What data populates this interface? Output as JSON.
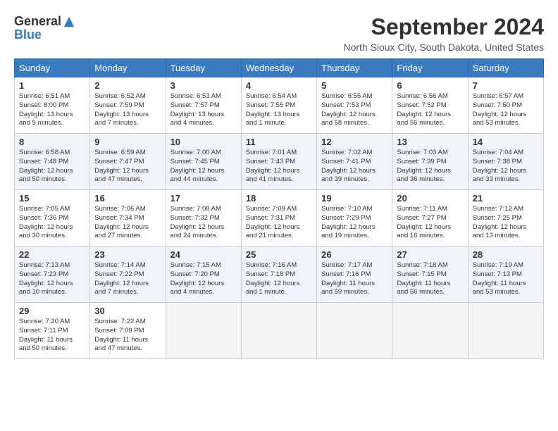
{
  "logo": {
    "general": "General",
    "blue": "Blue"
  },
  "title": "September 2024",
  "location": "North Sioux City, South Dakota, United States",
  "days_of_week": [
    "Sunday",
    "Monday",
    "Tuesday",
    "Wednesday",
    "Thursday",
    "Friday",
    "Saturday"
  ],
  "weeks": [
    [
      {
        "day": "1",
        "info": "Sunrise: 6:51 AM\nSunset: 8:00 PM\nDaylight: 13 hours\nand 9 minutes."
      },
      {
        "day": "2",
        "info": "Sunrise: 6:52 AM\nSunset: 7:59 PM\nDaylight: 13 hours\nand 7 minutes."
      },
      {
        "day": "3",
        "info": "Sunrise: 6:53 AM\nSunset: 7:57 PM\nDaylight: 13 hours\nand 4 minutes."
      },
      {
        "day": "4",
        "info": "Sunrise: 6:54 AM\nSunset: 7:55 PM\nDaylight: 13 hours\nand 1 minute."
      },
      {
        "day": "5",
        "info": "Sunrise: 6:55 AM\nSunset: 7:53 PM\nDaylight: 12 hours\nand 58 minutes."
      },
      {
        "day": "6",
        "info": "Sunrise: 6:56 AM\nSunset: 7:52 PM\nDaylight: 12 hours\nand 55 minutes."
      },
      {
        "day": "7",
        "info": "Sunrise: 6:57 AM\nSunset: 7:50 PM\nDaylight: 12 hours\nand 53 minutes."
      }
    ],
    [
      {
        "day": "8",
        "info": "Sunrise: 6:58 AM\nSunset: 7:48 PM\nDaylight: 12 hours\nand 50 minutes."
      },
      {
        "day": "9",
        "info": "Sunrise: 6:59 AM\nSunset: 7:47 PM\nDaylight: 12 hours\nand 47 minutes."
      },
      {
        "day": "10",
        "info": "Sunrise: 7:00 AM\nSunset: 7:45 PM\nDaylight: 12 hours\nand 44 minutes."
      },
      {
        "day": "11",
        "info": "Sunrise: 7:01 AM\nSunset: 7:43 PM\nDaylight: 12 hours\nand 41 minutes."
      },
      {
        "day": "12",
        "info": "Sunrise: 7:02 AM\nSunset: 7:41 PM\nDaylight: 12 hours\nand 39 minutes."
      },
      {
        "day": "13",
        "info": "Sunrise: 7:03 AM\nSunset: 7:39 PM\nDaylight: 12 hours\nand 36 minutes."
      },
      {
        "day": "14",
        "info": "Sunrise: 7:04 AM\nSunset: 7:38 PM\nDaylight: 12 hours\nand 33 minutes."
      }
    ],
    [
      {
        "day": "15",
        "info": "Sunrise: 7:05 AM\nSunset: 7:36 PM\nDaylight: 12 hours\nand 30 minutes."
      },
      {
        "day": "16",
        "info": "Sunrise: 7:06 AM\nSunset: 7:34 PM\nDaylight: 12 hours\nand 27 minutes."
      },
      {
        "day": "17",
        "info": "Sunrise: 7:08 AM\nSunset: 7:32 PM\nDaylight: 12 hours\nand 24 minutes."
      },
      {
        "day": "18",
        "info": "Sunrise: 7:09 AM\nSunset: 7:31 PM\nDaylight: 12 hours\nand 21 minutes."
      },
      {
        "day": "19",
        "info": "Sunrise: 7:10 AM\nSunset: 7:29 PM\nDaylight: 12 hours\nand 19 minutes."
      },
      {
        "day": "20",
        "info": "Sunrise: 7:11 AM\nSunset: 7:27 PM\nDaylight: 12 hours\nand 16 minutes."
      },
      {
        "day": "21",
        "info": "Sunrise: 7:12 AM\nSunset: 7:25 PM\nDaylight: 12 hours\nand 13 minutes."
      }
    ],
    [
      {
        "day": "22",
        "info": "Sunrise: 7:13 AM\nSunset: 7:23 PM\nDaylight: 12 hours\nand 10 minutes."
      },
      {
        "day": "23",
        "info": "Sunrise: 7:14 AM\nSunset: 7:22 PM\nDaylight: 12 hours\nand 7 minutes."
      },
      {
        "day": "24",
        "info": "Sunrise: 7:15 AM\nSunset: 7:20 PM\nDaylight: 12 hours\nand 4 minutes."
      },
      {
        "day": "25",
        "info": "Sunrise: 7:16 AM\nSunset: 7:18 PM\nDaylight: 12 hours\nand 1 minute."
      },
      {
        "day": "26",
        "info": "Sunrise: 7:17 AM\nSunset: 7:16 PM\nDaylight: 11 hours\nand 59 minutes."
      },
      {
        "day": "27",
        "info": "Sunrise: 7:18 AM\nSunset: 7:15 PM\nDaylight: 11 hours\nand 56 minutes."
      },
      {
        "day": "28",
        "info": "Sunrise: 7:19 AM\nSunset: 7:13 PM\nDaylight: 11 hours\nand 53 minutes."
      }
    ],
    [
      {
        "day": "29",
        "info": "Sunrise: 7:20 AM\nSunset: 7:11 PM\nDaylight: 11 hours\nand 50 minutes."
      },
      {
        "day": "30",
        "info": "Sunrise: 7:22 AM\nSunset: 7:09 PM\nDaylight: 11 hours\nand 47 minutes."
      },
      {
        "day": "",
        "info": ""
      },
      {
        "day": "",
        "info": ""
      },
      {
        "day": "",
        "info": ""
      },
      {
        "day": "",
        "info": ""
      },
      {
        "day": "",
        "info": ""
      }
    ]
  ]
}
